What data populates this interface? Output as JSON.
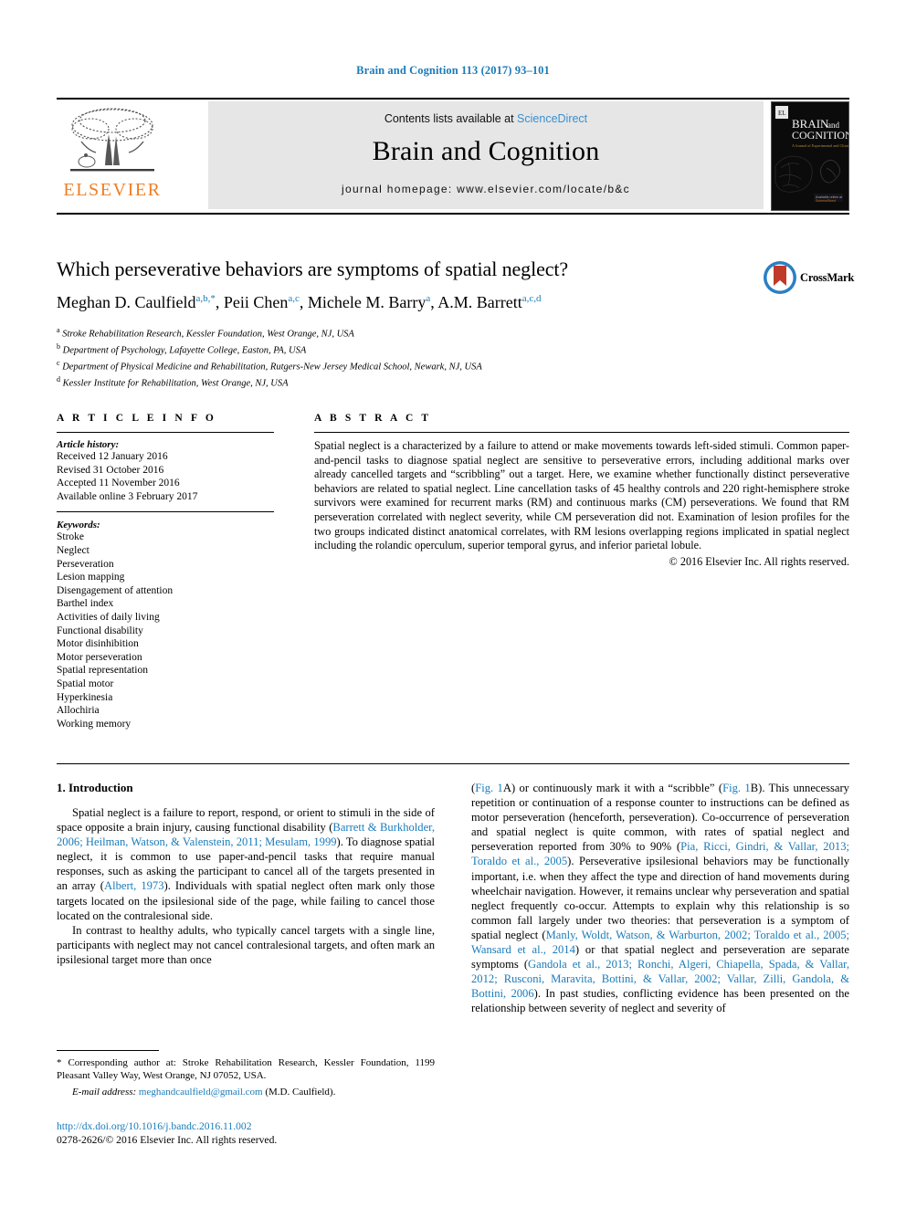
{
  "running_head": "Brain and Cognition 113 (2017) 93–101",
  "masthead": {
    "publisher_logo_label": "ELSEVIER",
    "contents_prefix": "Contents lists available at ",
    "contents_link": "ScienceDirect",
    "journal_title": "Brain and Cognition",
    "homepage": "journal homepage: www.elsevier.com/locate/b&c",
    "cover_title_line1": "BRAIN",
    "cover_title_and": "and",
    "cover_title_line2": "COGNITION",
    "cover_subtitle": "A Journal of Experimental and Clinical Sciences"
  },
  "article": {
    "title": "Which perseverative behaviors are symptoms of spatial neglect?",
    "authors": [
      {
        "name": "Meghan D. Caulfield",
        "sup": "a,b,*"
      },
      {
        "name": "Peii Chen",
        "sup": "a,c"
      },
      {
        "name": "Michele M. Barry",
        "sup": "a"
      },
      {
        "name": "A.M. Barrett",
        "sup": "a,c,d"
      }
    ],
    "affiliations": [
      {
        "marker": "a",
        "text": "Stroke Rehabilitation Research, Kessler Foundation, West Orange, NJ, USA"
      },
      {
        "marker": "b",
        "text": "Department of Psychology, Lafayette College, Easton, PA, USA"
      },
      {
        "marker": "c",
        "text": "Department of Physical Medicine and Rehabilitation, Rutgers-New Jersey Medical School, Newark, NJ, USA"
      },
      {
        "marker": "d",
        "text": "Kessler Institute for Rehabilitation, West Orange, NJ, USA"
      }
    ],
    "crossmark_label": "CrossMark"
  },
  "info": {
    "heading": "A R T I C L E  I N F O",
    "history_label": "Article history:",
    "history": [
      "Received 12 January 2016",
      "Revised 31 October 2016",
      "Accepted 11 November 2016",
      "Available online 3 February 2017"
    ],
    "keywords_label": "Keywords:",
    "keywords": [
      "Stroke",
      "Neglect",
      "Perseveration",
      "Lesion mapping",
      "Disengagement of attention",
      "Barthel index",
      "Activities of daily living",
      "Functional disability",
      "Motor disinhibition",
      "Motor perseveration",
      "Spatial representation",
      "Spatial motor",
      "Hyperkinesia",
      "Allochiria",
      "Working memory"
    ]
  },
  "abstract": {
    "heading": "A B S T R A C T",
    "text": "Spatial neglect is a characterized by a failure to attend or make movements towards left-sided stimuli. Common paper-and-pencil tasks to diagnose spatial neglect are sensitive to perseverative errors, including additional marks over already cancelled targets and “scribbling” out a target. Here, we examine whether functionally distinct perseverative behaviors are related to spatial neglect. Line cancellation tasks of 45 healthy controls and 220 right-hemisphere stroke survivors were examined for recurrent marks (RM) and continuous marks (CM) perseverations. We found that RM perseveration correlated with neglect severity, while CM perseveration did not. Examination of lesion profiles for the two groups indicated distinct anatomical correlates, with RM lesions overlapping regions implicated in spatial neglect including the rolandic operculum, superior temporal gyrus, and inferior parietal lobule.",
    "copyright": "© 2016 Elsevier Inc. All rights reserved."
  },
  "body": {
    "section_heading": "1. Introduction",
    "left_para_1": {
      "seg1": "Spatial neglect is a failure to report, respond, or orient to stimuli in the side of space opposite a brain injury, causing functional disability (",
      "ref1": "Barrett & Burkholder, 2006; Heilman, Watson, & Valenstein, 2011; Mesulam, 1999",
      "seg2": "). To diagnose spatial neglect, it is common to use paper-and-pencil tasks that require manual responses, such as asking the participant to cancel all of the targets presented in an array (",
      "ref2": "Albert, 1973",
      "seg3": "). Individuals with spatial neglect often mark only those targets located on the ipsilesional side of the page, while failing to cancel those located on the contralesional side."
    },
    "left_para_2": "In contrast to healthy adults, who typically cancel targets with a single line, participants with neglect may not cancel contralesional targets, and often mark an ipsilesional target more than once",
    "right_para_1": {
      "seg1": "(",
      "ref1": "Fig. 1",
      "seg2": "A) or continuously mark it with a “scribble” (",
      "ref2": "Fig. 1",
      "seg3": "B). This unnecessary repetition or continuation of a response counter to instructions can be defined as motor perseveration (henceforth, perseveration). Co-occurrence of perseveration and spatial neglect is quite common, with rates of spatial neglect and perseveration reported from 30% to 90% (",
      "ref3": "Pia, Ricci, Gindri, & Vallar, 2013; Toraldo et al., 2005",
      "seg4": "). Perseverative ipsilesional behaviors may be functionally important, i.e. when they affect the type and direction of hand movements during wheelchair navigation. However, it remains unclear why perseveration and spatial neglect frequently co-occur. Attempts to explain why this relationship is so common fall largely under two theories: that perseveration is a symptom of spatial neglect (",
      "ref4": "Manly, Woldt, Watson, & Warburton, 2002; Toraldo et al., 2005; Wansard et al., 2014",
      "seg5": ") or that spatial neglect and perseveration are separate symptoms (",
      "ref5": "Gandola et al., 2013; Ronchi, Algeri, Chiapella, Spada, & Vallar, 2012; Rusconi, Maravita, Bottini, & Vallar, 2002; Vallar, Zilli, Gandola, & Bottini, 2006",
      "seg6": "). In past studies, conflicting evidence has been presented on the relationship between severity of neglect and severity of"
    }
  },
  "footnotes": {
    "corresponding": "* Corresponding author at: Stroke Rehabilitation Research, Kessler Foundation, 1199 Pleasant Valley Way, West Orange, NJ 07052, USA.",
    "email_label": "E-mail address:",
    "email": "meghandcaulfield@gmail.com",
    "email_owner": "(M.D. Caulfield).",
    "doi": "http://dx.doi.org/10.1016/j.bandc.2016.11.002",
    "issn_line": "0278-2626/© 2016 Elsevier Inc. All rights reserved."
  },
  "colors": {
    "link": "#1a7bb9",
    "elsevier_orange": "#f07d22",
    "band_grey": "#e6e6e6"
  }
}
